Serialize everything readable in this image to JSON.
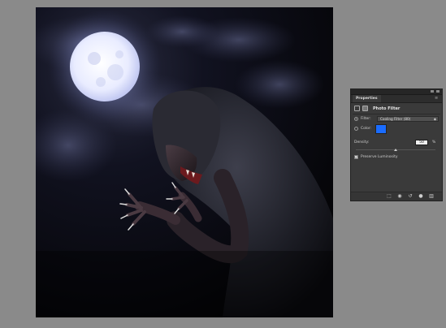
{
  "panel": {
    "tab_label": "Properties",
    "adjustment_title": "Photo Filter",
    "filter_label": "Filter:",
    "filter_value": "Cooling Filter (80)",
    "color_label": "Color:",
    "color_swatch": "#1a6cff",
    "density_label": "Density:",
    "density_value": "50",
    "density_unit": "%",
    "density_level": 0.5,
    "preserve_luminosity_label": "Preserve Luminosity",
    "preserve_luminosity_checked": true
  },
  "icons": {
    "filter_radio": "radio-icon",
    "color_radio": "radio-icon",
    "panel_menu": "panel-menu-icon",
    "footer": [
      "clip-to-layer-icon",
      "view-previous-state-icon",
      "reset-icon",
      "visibility-eye-icon",
      "trash-icon"
    ]
  },
  "colors": {
    "workspace_bg": "#8a8a8a",
    "panel_bg": "#3a3a3a",
    "canvas_bg": "#050508"
  }
}
